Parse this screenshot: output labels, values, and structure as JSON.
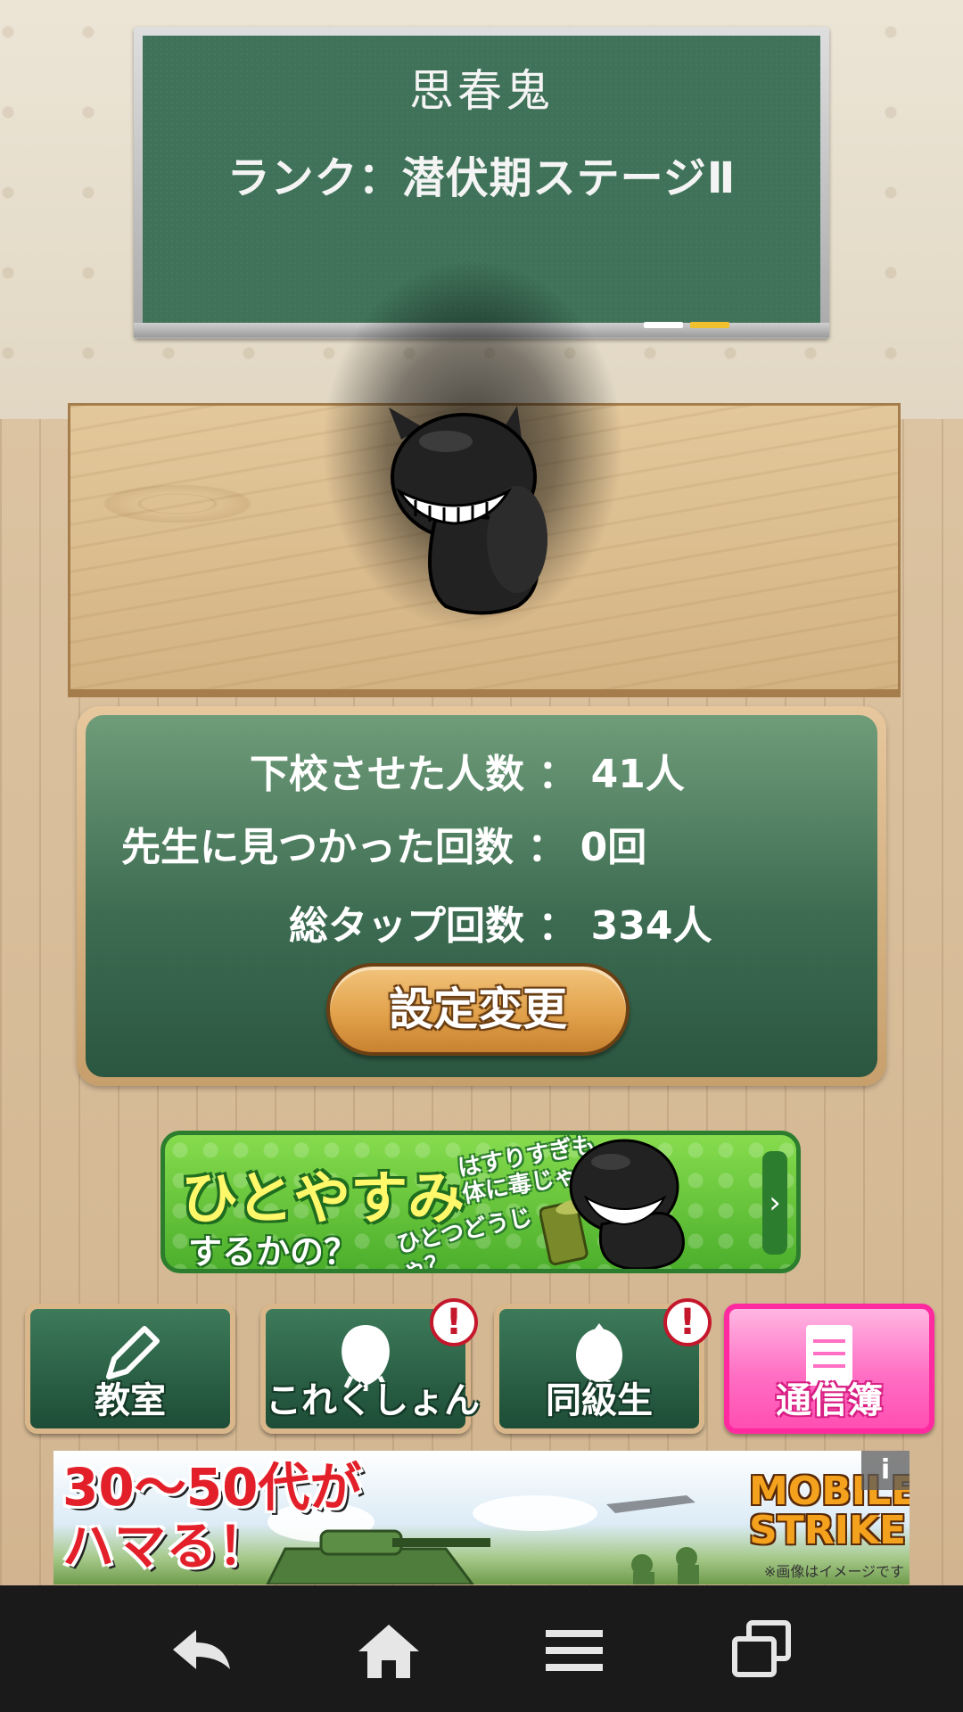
{
  "blackboard": {
    "name": "思春鬼",
    "rank": "ランク：潜伏期ステージⅡ"
  },
  "stats": {
    "rows": [
      {
        "label": "下校させた人数",
        "sep": "：",
        "value": "41人"
      },
      {
        "label": "先生に見つかった回数",
        "sep": "：",
        "value": "0回"
      },
      {
        "label": "総タップ回数",
        "sep": "：",
        "value": "334人"
      }
    ],
    "settings_button": "設定変更"
  },
  "banner": {
    "title": "ひとやすみ",
    "subtitle": "するかの？",
    "note_top": "はすりすぎも体に毒じゃ",
    "note_bottom": "ひとつどうじゃ？",
    "arrow_icon": "chevron-right-icon"
  },
  "nav": {
    "items": [
      {
        "label": "教室",
        "icon": "pencil-icon",
        "alert": false
      },
      {
        "label": "これくしょん",
        "icon": "collection-icon",
        "alert": true
      },
      {
        "label": "同級生",
        "icon": "classmate-icon",
        "alert": true
      },
      {
        "label": "通信簿",
        "icon": "report-card-icon",
        "alert": false
      }
    ],
    "alert_mark": "!"
  },
  "ad": {
    "headline_line1": "30～50代が",
    "headline_line2": "ハマる！",
    "brand_line1": "MOBILE",
    "brand_line2": "STRIKE",
    "disclaimer": "※画像はイメージです",
    "info_icon": "i"
  },
  "system_nav": {
    "icons": [
      "back-icon",
      "home-icon",
      "menu-icon",
      "recent-apps-icon"
    ]
  },
  "colors": {
    "board": "#3f7258",
    "panel": "#3d6c52",
    "accent_orange": "#e2a24b",
    "banner_green": "#4caf2c",
    "pink": "#ff6fc4",
    "alert_red": "#c5172b"
  }
}
